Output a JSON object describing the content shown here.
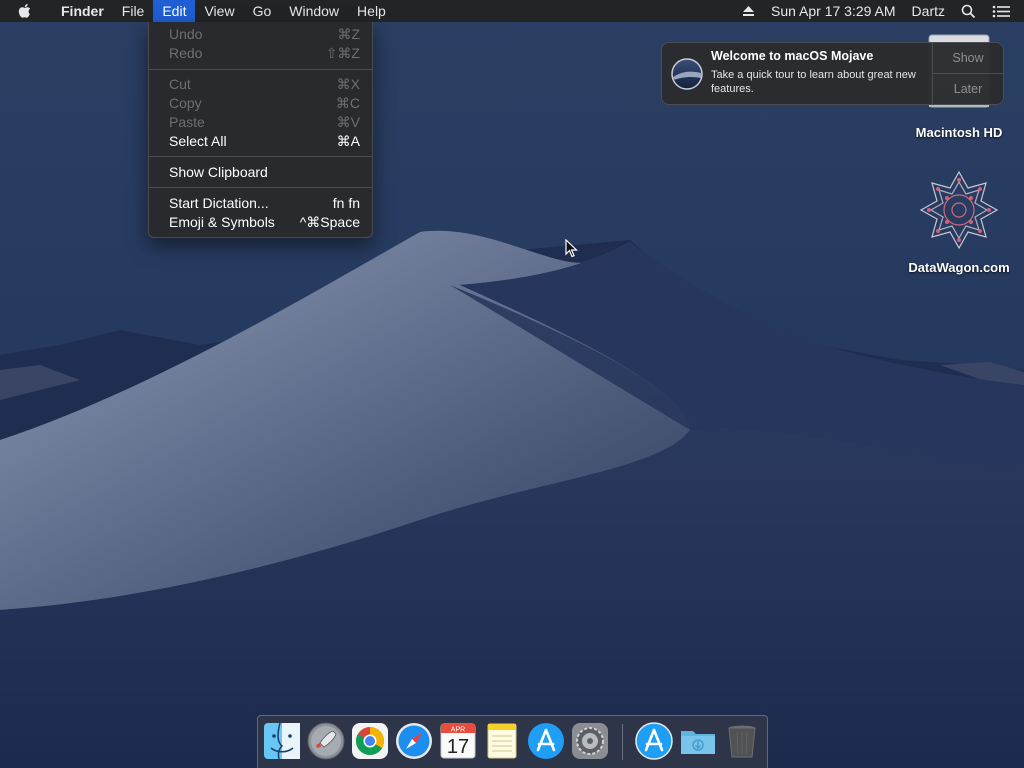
{
  "menubar": {
    "app_name": "Finder",
    "items": [
      "File",
      "Edit",
      "View",
      "Go",
      "Window",
      "Help"
    ],
    "clock": "Sun Apr 17  3:29 AM",
    "user": "Dartz"
  },
  "edit_menu": {
    "items": [
      {
        "label": "Undo",
        "shortcut": "⌘Z",
        "enabled": false
      },
      {
        "label": "Redo",
        "shortcut": "⇧⌘Z",
        "enabled": false
      },
      {
        "label": "Cut",
        "shortcut": "⌘X",
        "enabled": false
      },
      {
        "label": "Copy",
        "shortcut": "⌘C",
        "enabled": false
      },
      {
        "label": "Paste",
        "shortcut": "⌘V",
        "enabled": false
      },
      {
        "label": "Select All",
        "shortcut": "⌘A",
        "enabled": true
      },
      {
        "label": "Show Clipboard",
        "shortcut": "",
        "enabled": true
      },
      {
        "label": "Start Dictation...",
        "shortcut": "fn fn",
        "enabled": true
      },
      {
        "label": "Emoji & Symbols",
        "shortcut": "^⌘Space",
        "enabled": true
      }
    ]
  },
  "notification": {
    "title": "Welcome to macOS Mojave",
    "body": "Take a quick tour to learn about great new features.",
    "show_label": "Show",
    "later_label": "Later"
  },
  "desktop_icons": {
    "drive_label": "Macintosh HD",
    "site_label": "DataWagon.com"
  },
  "calendar_icon": {
    "month": "APR",
    "day": "17"
  },
  "dock": {
    "apps": [
      "finder-icon",
      "launchpad-icon",
      "chrome-icon",
      "safari-icon",
      "calendar-icon",
      "notes-icon",
      "app-store-icon",
      "system-preferences-icon",
      "app-store-download-icon",
      "downloads-folder-icon",
      "trash-icon"
    ]
  },
  "colors": {
    "menu_highlight": "#1f5fd6",
    "menubar_bg": "#232426"
  }
}
